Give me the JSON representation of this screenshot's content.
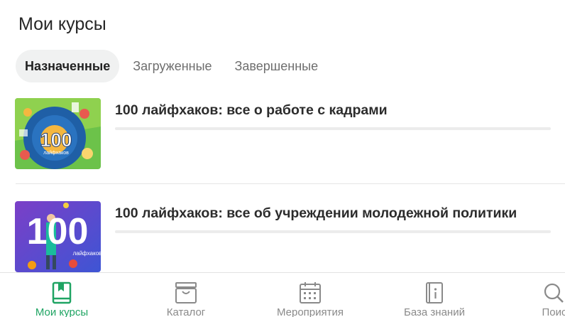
{
  "header": {
    "title": "Мои курсы"
  },
  "tabs": [
    {
      "label": "Назначенные",
      "active": true
    },
    {
      "label": "Загруженные",
      "active": false
    },
    {
      "label": "Завершенные",
      "active": false
    }
  ],
  "courses": [
    {
      "title": "100 лайфхаков: все о работе с кадрами",
      "thumb_text": "100",
      "thumb_sub": "лайфхаков",
      "progress": 0
    },
    {
      "title": "100 лайфхаков: все об учреждении молодежной политики",
      "thumb_text": "100",
      "thumb_sub": "лайфхаков",
      "progress": 0
    }
  ],
  "bottom_nav": [
    {
      "label": "Мои курсы",
      "icon": "book-icon",
      "active": true
    },
    {
      "label": "Каталог",
      "icon": "catalog-box-icon",
      "active": false
    },
    {
      "label": "Мероприятия",
      "icon": "calendar-icon",
      "active": false
    },
    {
      "label": "База знаний",
      "icon": "info-book-icon",
      "active": false
    },
    {
      "label": "Поис",
      "icon": "search-icon",
      "active": false
    }
  ],
  "colors": {
    "accent": "#1fa463",
    "inactive": "#8a8a8a",
    "tab_active_bg": "#f0f1f1"
  }
}
